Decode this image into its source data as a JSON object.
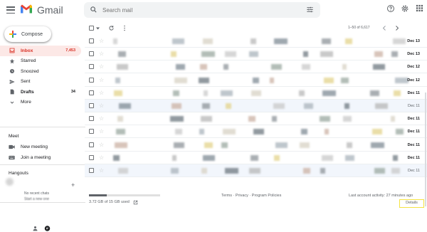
{
  "app": {
    "name": "Gmail"
  },
  "search": {
    "placeholder": "Search mail"
  },
  "compose": {
    "label": "Compose"
  },
  "nav": [
    {
      "label": "Inbox",
      "icon": "inbox-icon",
      "count": "7,453",
      "active": true
    },
    {
      "label": "Starred",
      "icon": "star-icon",
      "count": ""
    },
    {
      "label": "Snoozed",
      "icon": "clock-icon",
      "count": ""
    },
    {
      "label": "Sent",
      "icon": "send-icon",
      "count": ""
    },
    {
      "label": "Drafts",
      "icon": "draft-icon",
      "count": "34"
    },
    {
      "label": "More",
      "icon": "chevron-down-icon",
      "count": ""
    }
  ],
  "meet": {
    "title": "Meet",
    "items": [
      {
        "label": "New meeting",
        "icon": "video-icon"
      },
      {
        "label": "Join a meeting",
        "icon": "keyboard-icon"
      }
    ]
  },
  "hangouts": {
    "title": "Hangouts",
    "no_chats": "No recent chats",
    "start_prefix": "Start a new one"
  },
  "toolbar": {
    "page_text": "1–50 of 6,617"
  },
  "emails": [
    {
      "date": "Dec 13",
      "read": false
    },
    {
      "date": "Dec 13",
      "read": false
    },
    {
      "date": "Dec 12",
      "read": false
    },
    {
      "date": "Dec 12",
      "read": false
    },
    {
      "date": "Dec 11",
      "read": false
    },
    {
      "date": "Dec 11",
      "read": true
    },
    {
      "date": "Dec 11",
      "read": false
    },
    {
      "date": "Dec 11",
      "read": false
    },
    {
      "date": "Dec 11",
      "read": false
    },
    {
      "date": "Dec 11",
      "read": false
    },
    {
      "date": "Dec 11",
      "read": true
    }
  ],
  "footer": {
    "storage": "3.72 GB of 15 GB used",
    "storage_fraction": 0.25,
    "policies": "Terms · Privacy · Program Policies",
    "activity": "Last account activity: 27 minutes ago",
    "details": "Details"
  },
  "colors": {
    "accent": "#d93025",
    "inbox_bg": "#fce8e6",
    "highlight": "#f5e342"
  }
}
